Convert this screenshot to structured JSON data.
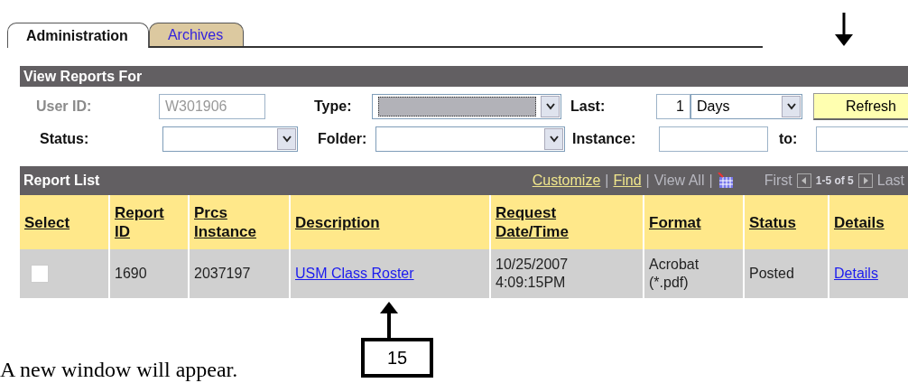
{
  "tabs": [
    {
      "label": "Administration",
      "selected": true
    },
    {
      "label": "Archives",
      "selected": false
    }
  ],
  "filter_panel": {
    "title": "View Reports For",
    "user_id": {
      "label": "User ID:",
      "value": "W301906",
      "disabled": true
    },
    "type": {
      "label": "Type:"
    },
    "last": {
      "label": "Last:",
      "value": "1",
      "unit": "Days"
    },
    "refresh_button": "Refresh",
    "status": {
      "label": "Status:"
    },
    "folder": {
      "label": "Folder:"
    },
    "instance": {
      "label": "Instance:",
      "to_label": "to:"
    }
  },
  "report_list": {
    "title": "Report List",
    "toolbar": [
      {
        "kind": "link",
        "text": "Customize"
      },
      {
        "kind": "separator",
        "text": "|"
      },
      {
        "kind": "link",
        "text": "Find"
      },
      {
        "kind": "separator",
        "text": "|"
      },
      {
        "kind": "dim",
        "text": "View All"
      },
      {
        "kind": "separator",
        "text": "|"
      }
    ],
    "first": "First",
    "range": "1-5 of 5",
    "last": "Last",
    "columns": [
      "Select",
      "Report ID",
      "Prcs Instance",
      "Description",
      "Request Date/Time",
      "Format",
      "Status",
      "Details"
    ],
    "rows": [
      {
        "checked": false,
        "report_id": "1690",
        "prcs_instance": "2037197",
        "description": "USM Class Roster",
        "request_date": "10/25/2007",
        "request_time": "4:09:15PM",
        "format": "Acrobat (*.pdf)",
        "status": "Posted",
        "details": "Details"
      }
    ]
  },
  "callout": {
    "number": "15"
  },
  "caption": "A new window will appear."
}
